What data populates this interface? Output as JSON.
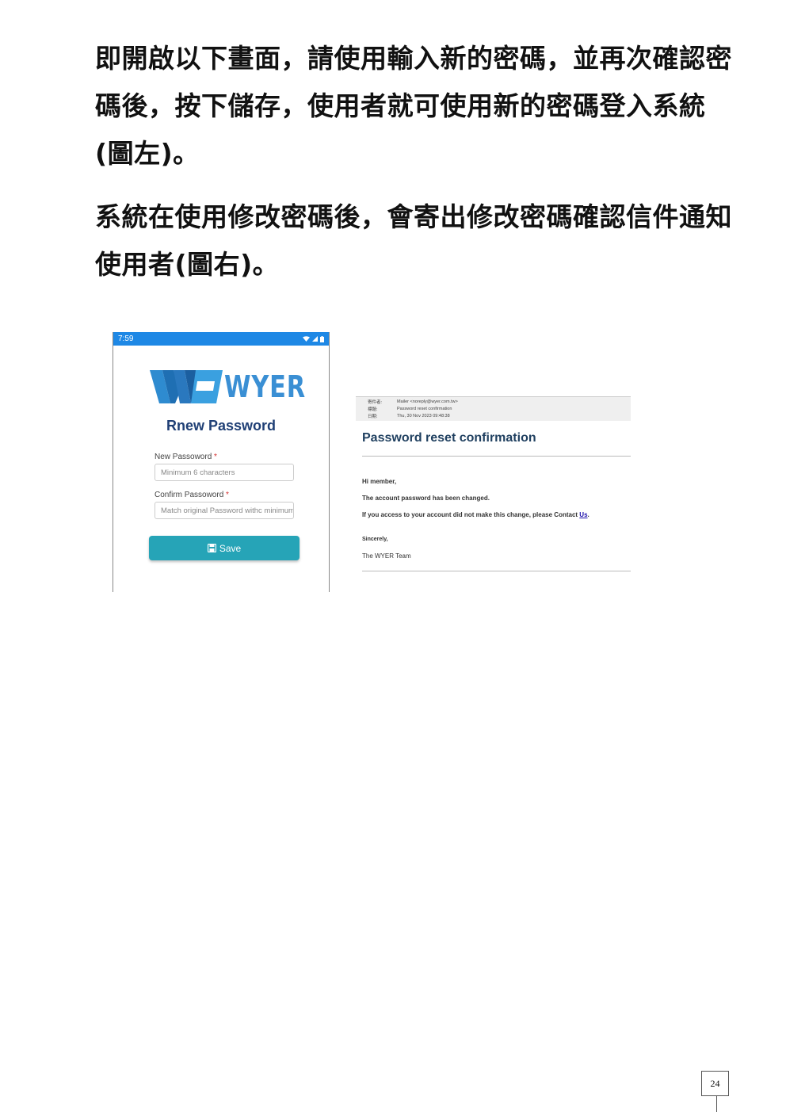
{
  "paragraphs": [
    "即開啟以下畫面，請使用輸入新的密碼，並再次確認密碼後，按下儲存，使用者就可使用新的密碼登入系統 (圖左)。",
    "系統在使用修改密碼後，會寄出修改密碼確認信件通知使用者(圖右)。"
  ],
  "phone": {
    "time": "7:59",
    "logo_text": "WYER",
    "title": "Rnew Password",
    "new_password_label": "New Passoword",
    "new_password_placeholder": "Minimum 6 characters",
    "confirm_password_label": "Confirm Passoword",
    "confirm_password_placeholder": "Match original Password withc minimum",
    "required_mark": "*",
    "save_label": "Save",
    "colors": {
      "statusbar": "#1e88e5",
      "button": "#26a4b7",
      "title": "#1f3f75",
      "logo": "#3a8fd4"
    }
  },
  "email": {
    "from_key": "寄件者:",
    "from_value": "Mailer <noreply@wyer.com.tw>",
    "subject_key": "標題:",
    "subject_value": "Password reset confirmation",
    "date_key": "日期:",
    "date_value": "Thu, 30 Nov 2023 09:48:38",
    "title": "Password reset confirmation",
    "greeting": "Hi member,",
    "line1": "The account password has been changed.",
    "line2_prefix": "If you access to your account did not make this change, please Contact ",
    "line2_link": "Us",
    "line2_suffix": ".",
    "sign1": "Sincerely,",
    "sign2": "The WYER Team"
  },
  "page_number": "24"
}
